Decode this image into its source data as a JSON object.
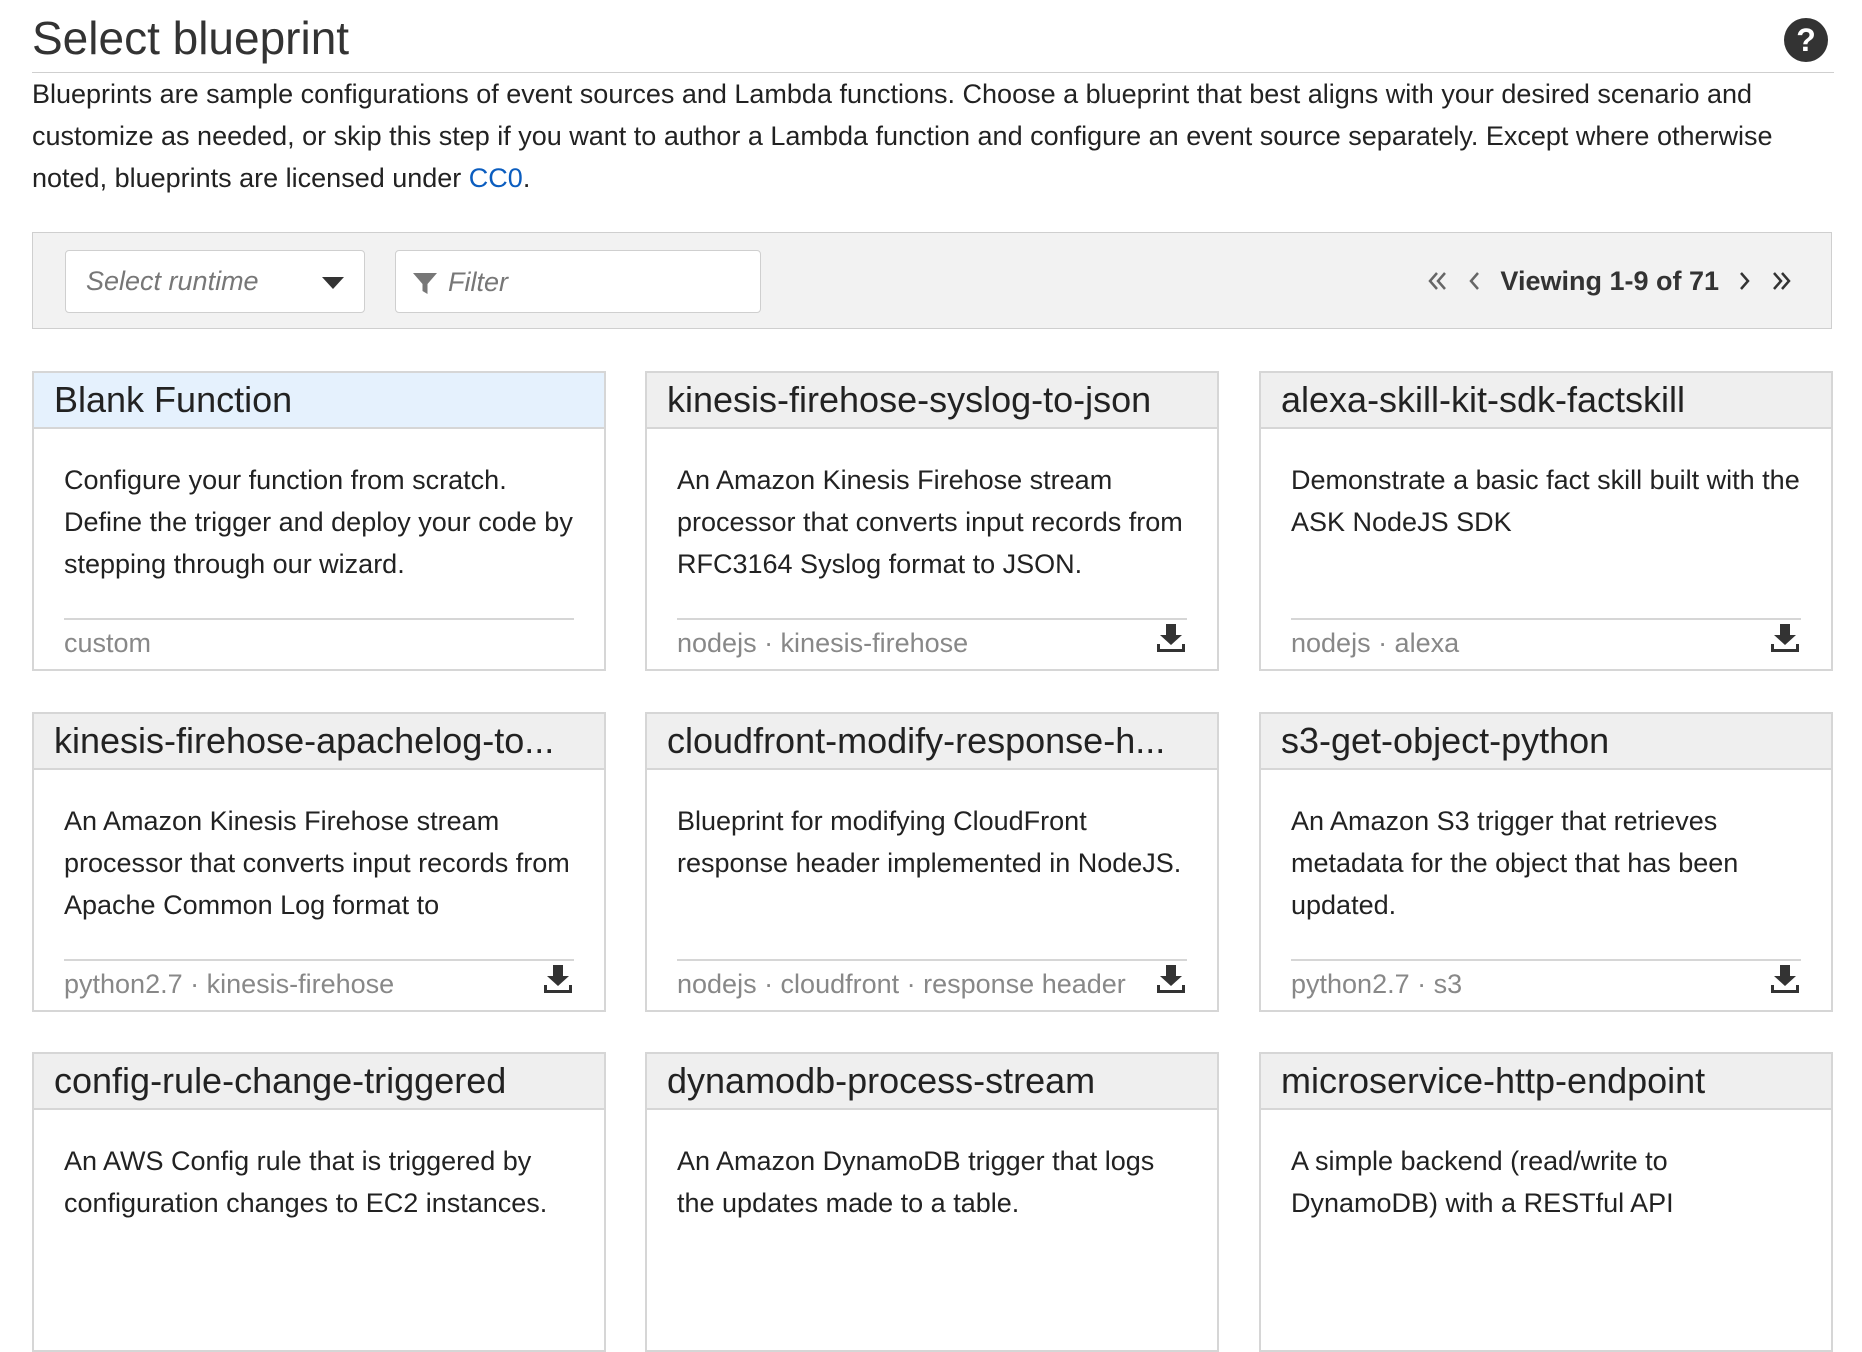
{
  "header": {
    "title": "Select blueprint",
    "help_icon": "question-circle-icon",
    "help_glyph": "?"
  },
  "description": {
    "text": "Blueprints are sample configurations of event sources and Lambda functions. Choose a blueprint that best aligns with your desired scenario and customize as needed, or skip this step if you want to author a Lambda function and configure an event source separately. Except where otherwise noted, blueprints are licensed under ",
    "link": "CC0",
    "suffix": "."
  },
  "toolbar": {
    "runtime_placeholder": "Select runtime",
    "filter_placeholder": "Filter",
    "viewing": "Viewing 1-9 of 71"
  },
  "cards": [
    {
      "title": "Blank Function",
      "desc": "Configure your function from scratch. Define the trigger and deploy your code by stepping through our wizard.",
      "tags": "custom",
      "download": false,
      "selected": true
    },
    {
      "title": "kinesis-firehose-syslog-to-json",
      "desc": "An Amazon Kinesis Firehose stream processor that converts input records from RFC3164 Syslog format to JSON.",
      "tags": "nodejs · kinesis-firehose",
      "download": true
    },
    {
      "title": "alexa-skill-kit-sdk-factskill",
      "desc": "Demonstrate a basic fact skill built with the ASK NodeJS SDK",
      "tags": "nodejs · alexa",
      "download": true
    },
    {
      "title": "kinesis-firehose-apachelog-to...",
      "desc": "An Amazon Kinesis Firehose stream processor that converts input records from Apache Common Log format to",
      "tags": "python2.7 · kinesis-firehose",
      "download": true
    },
    {
      "title": "cloudfront-modify-response-h...",
      "desc": "Blueprint for modifying CloudFront response header implemented in NodeJS.",
      "tags": "nodejs · cloudfront · response header",
      "download": true
    },
    {
      "title": "s3-get-object-python",
      "desc": "An Amazon S3 trigger that retrieves metadata for the object that has been updated.",
      "tags": "python2.7 · s3",
      "download": true
    },
    {
      "title": "config-rule-change-triggered",
      "desc": "An AWS Config rule that is triggered by configuration changes to EC2 instances.",
      "tags": "",
      "download": true
    },
    {
      "title": "dynamodb-process-stream",
      "desc": "An Amazon DynamoDB trigger that logs the updates made to a table.",
      "tags": "",
      "download": true
    },
    {
      "title": "microservice-http-endpoint",
      "desc": "A simple backend (read/write to DynamoDB) with a RESTful API",
      "tags": "",
      "download": true
    }
  ],
  "colors": {
    "link": "#0b5dbf",
    "selected_header": "#e5f1fd",
    "card_header": "#efefef"
  }
}
